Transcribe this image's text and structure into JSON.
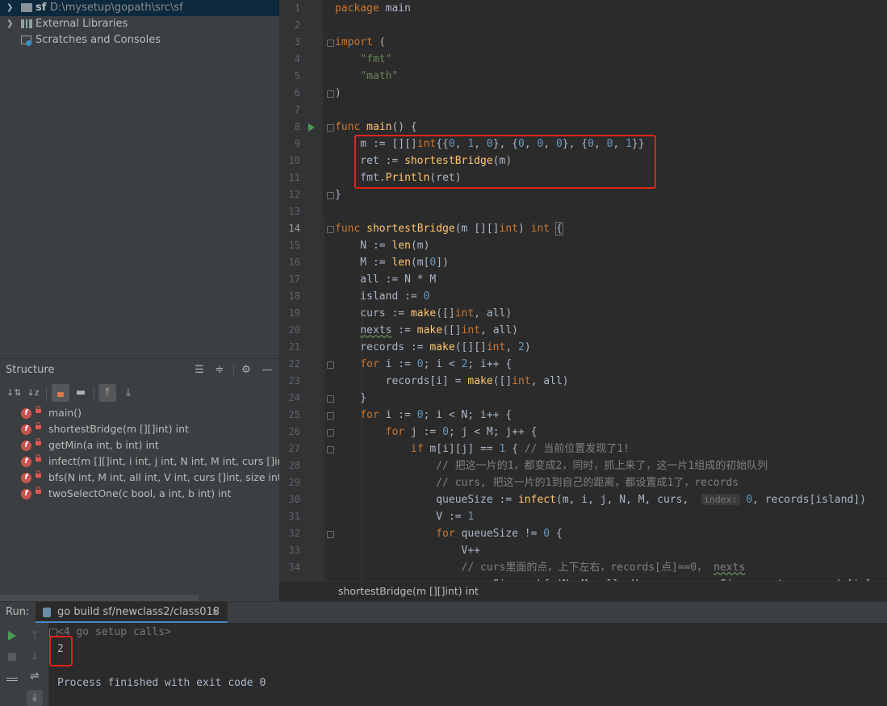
{
  "project": {
    "rows": [
      {
        "name": "sf",
        "path": "D:\\mysetup\\gopath\\src\\sf"
      },
      {
        "name": "External Libraries"
      },
      {
        "name": "Scratches and Consoles"
      }
    ]
  },
  "structure": {
    "title": "Structure",
    "items": [
      "main()",
      "shortestBridge(m [][]int) int",
      "getMin(a int, b int) int",
      "infect(m [][]int, i int, j int, N int, M int, curs []int, inc",
      "bfs(N int, M int, all int, V int, curs []int, size int, nex",
      "twoSelectOne(c bool, a int, b int) int"
    ]
  },
  "editor": {
    "line_numbers": [
      "1",
      "2",
      "3",
      "4",
      "5",
      "6",
      "7",
      "8",
      "9",
      "10",
      "11",
      "12",
      "13",
      "14",
      "15",
      "16",
      "17",
      "18",
      "19",
      "20",
      "21",
      "22",
      "23",
      "24",
      "25",
      "26",
      "27",
      "28",
      "29",
      "30",
      "31",
      "32",
      "33",
      "34"
    ],
    "current_line": "14",
    "breadcrumb": "shortestBridge(m [][]int) int"
  },
  "run": {
    "label": "Run:",
    "tab": "go build sf/newclass2/class018",
    "setup_calls": "<4 go setup calls>",
    "output": "2",
    "finished": "Process finished with exit code 0"
  },
  "colors": {
    "highlight_box": "#e3221a",
    "keyword": "#cc7832",
    "string": "#6a8759",
    "number": "#6897bb",
    "function": "#ffc66d"
  }
}
